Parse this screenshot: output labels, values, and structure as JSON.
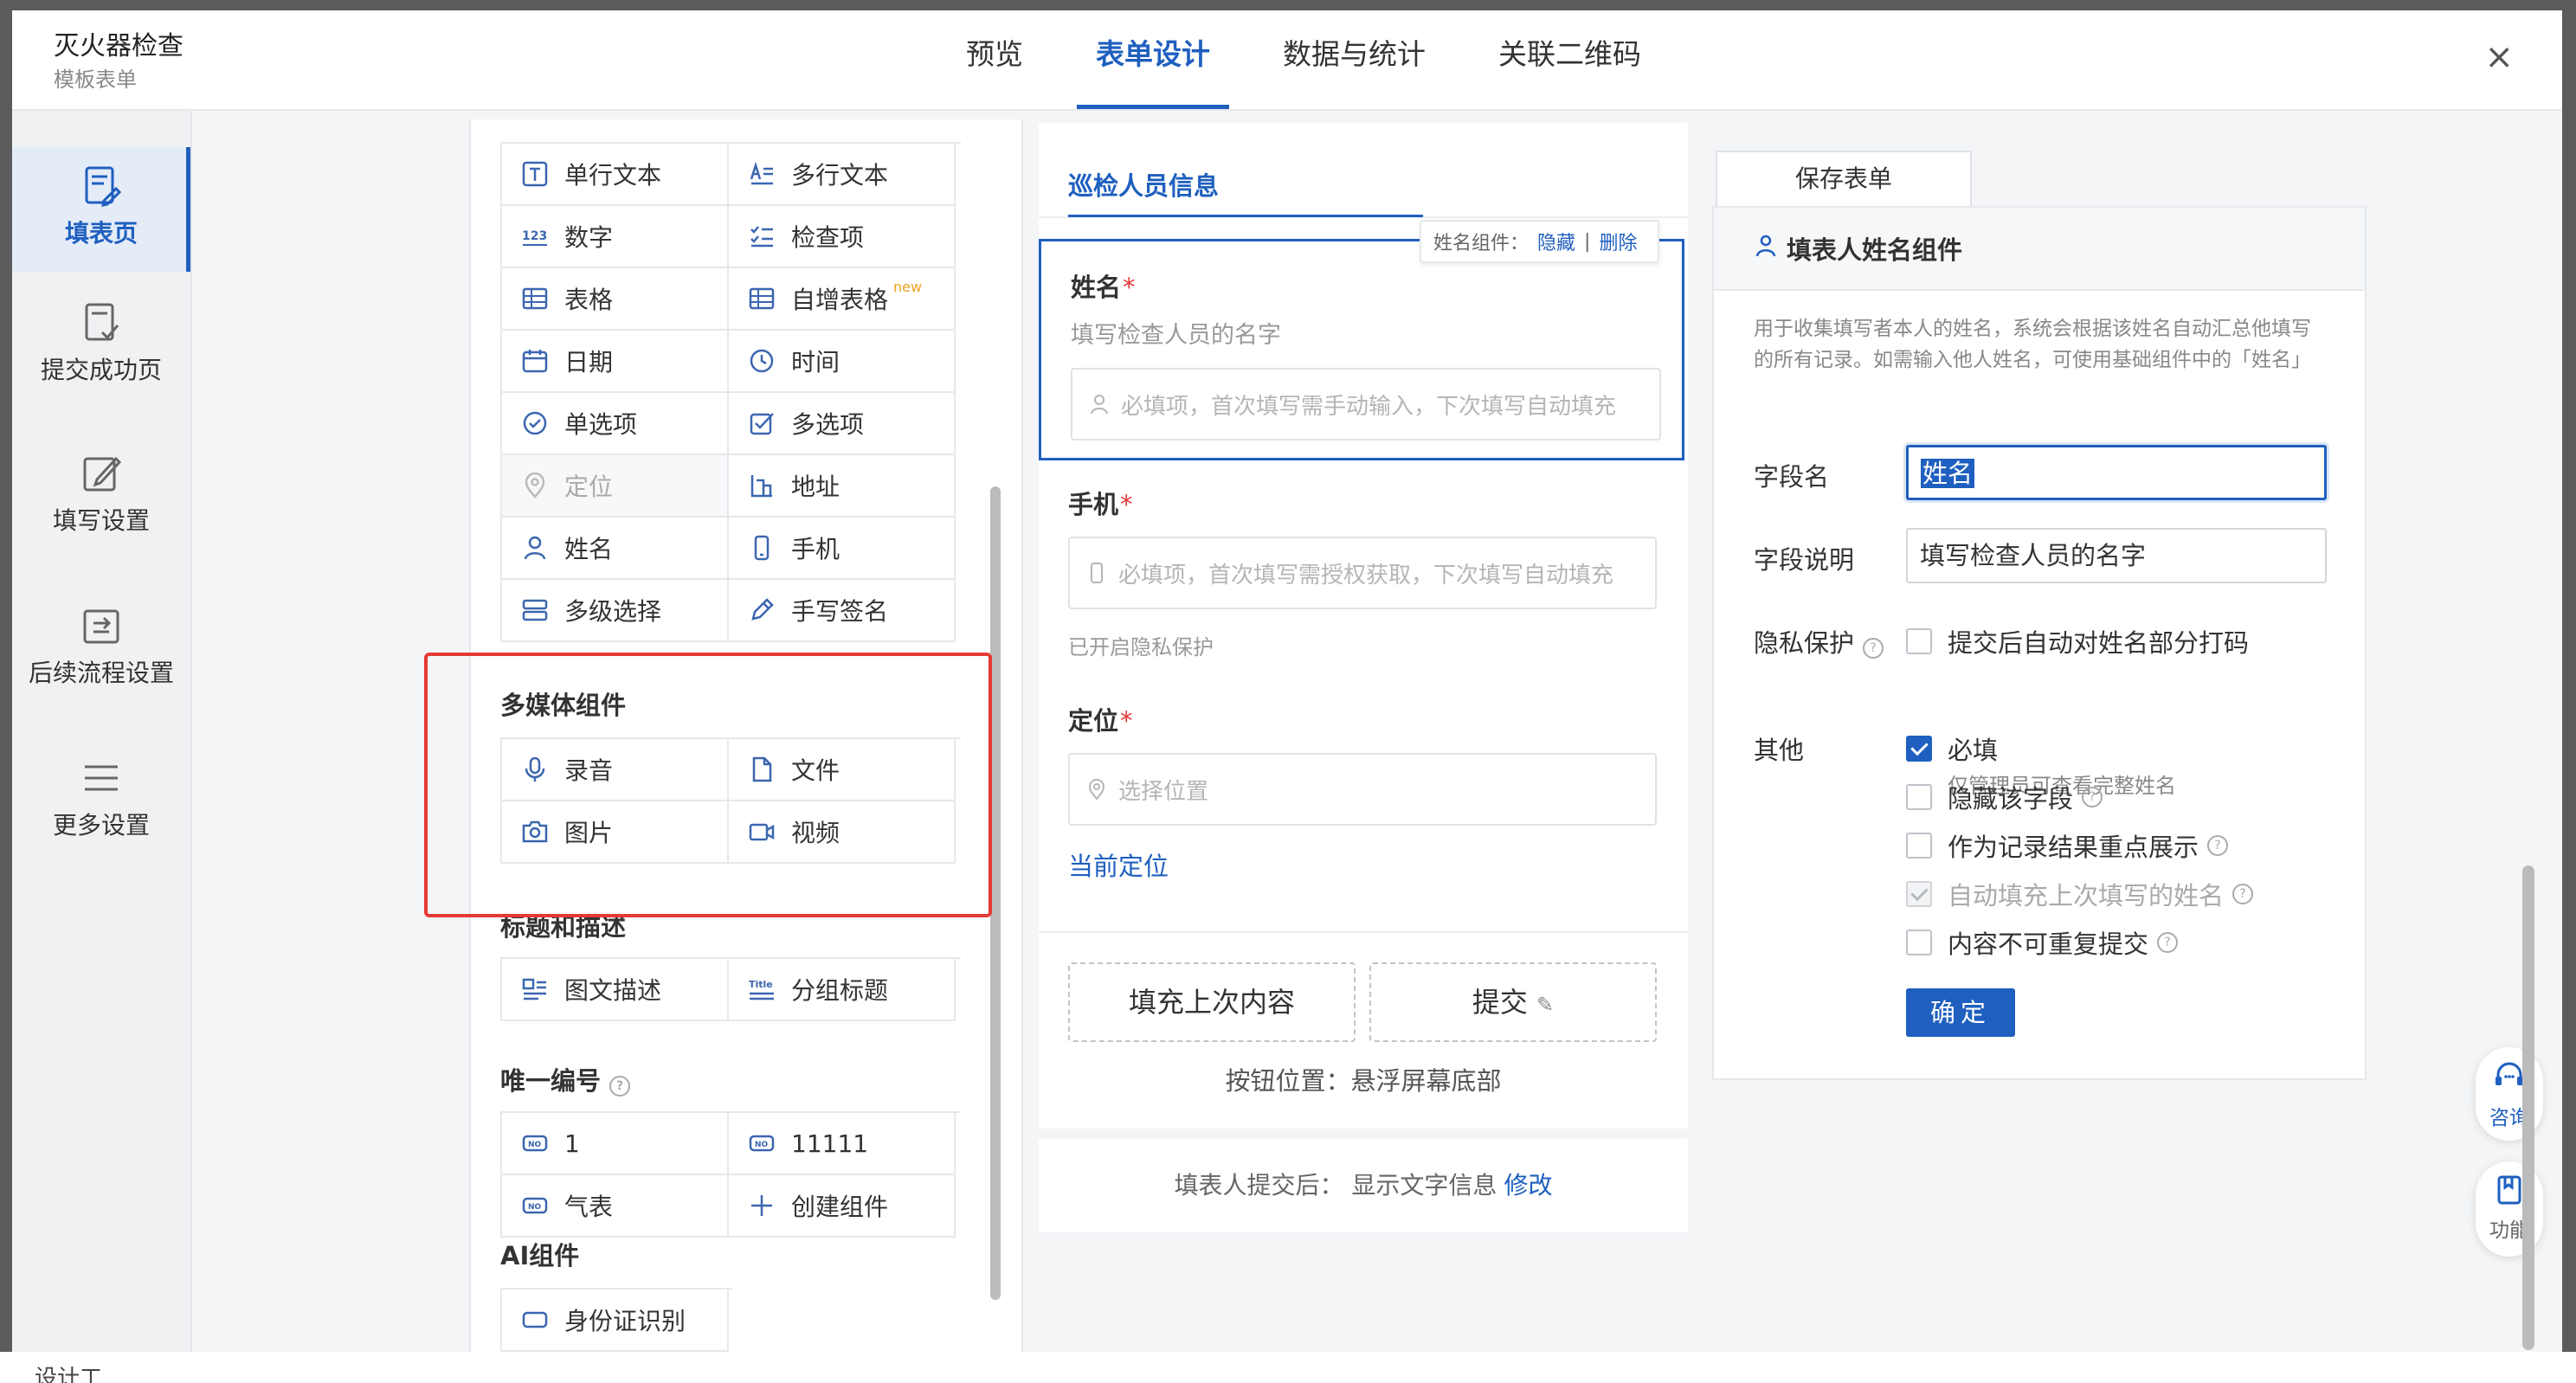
{
  "app": {
    "title": "灭火器检查",
    "subtitle": "模板表单",
    "close_label": "×"
  },
  "tabs": [
    "预览",
    "表单设计",
    "数据与统计",
    "关联二维码"
  ],
  "nav": [
    {
      "label": "填表页",
      "icon": "form-page-icon"
    },
    {
      "label": "提交成功页",
      "icon": "submit-success-icon"
    },
    {
      "label": "填写设置",
      "icon": "edit-settings-icon"
    },
    {
      "label": "后续流程设置",
      "icon": "workflow-icon"
    },
    {
      "label": "更多设置",
      "icon": "menu-lines-icon"
    }
  ],
  "components": {
    "basic": [
      {
        "label": "单行文本",
        "icon": "text-t-icon"
      },
      {
        "label": "多行文本",
        "icon": "multiline-text-icon"
      },
      {
        "label": "数字",
        "icon": "number-123-icon"
      },
      {
        "label": "检查项",
        "icon": "checklist-icon"
      },
      {
        "label": "表格",
        "icon": "table-icon"
      },
      {
        "label": "自增表格",
        "icon": "table-icon",
        "tag": "new"
      },
      {
        "label": "日期",
        "icon": "calendar-icon"
      },
      {
        "label": "时间",
        "icon": "clock-icon"
      },
      {
        "label": "单选项",
        "icon": "radio-check-icon"
      },
      {
        "label": "多选项",
        "icon": "checkbox-icon"
      },
      {
        "label": "定位",
        "icon": "location-pin-icon",
        "disabled": true
      },
      {
        "label": "地址",
        "icon": "address-icon"
      },
      {
        "label": "姓名",
        "icon": "person-icon"
      },
      {
        "label": "手机",
        "icon": "phone-icon"
      },
      {
        "label": "多级选择",
        "icon": "cascade-select-icon"
      },
      {
        "label": "手写签名",
        "icon": "pen-signature-icon"
      }
    ],
    "multimedia_title": "多媒体组件",
    "multimedia": [
      {
        "label": "录音",
        "icon": "microphone-icon"
      },
      {
        "label": "文件",
        "icon": "file-icon"
      },
      {
        "label": "图片",
        "icon": "camera-icon"
      },
      {
        "label": "视频",
        "icon": "video-icon"
      }
    ],
    "title_desc_title": "标题和描述",
    "title_desc": [
      {
        "label": "图文描述",
        "icon": "image-text-icon"
      },
      {
        "label": "分组标题",
        "icon": "group-title-icon"
      }
    ],
    "unique_title": "唯一编号",
    "unique": [
      {
        "label": "1",
        "icon": "no-badge-icon"
      },
      {
        "label": "11111",
        "icon": "no-badge-icon"
      },
      {
        "label": "气表",
        "icon": "no-badge-icon"
      },
      {
        "label": "创建组件",
        "icon": "plus-icon"
      }
    ],
    "ai_title": "AI组件",
    "ai": [
      {
        "label": "身份证识别",
        "icon": "id-card-icon"
      }
    ]
  },
  "form": {
    "section_title": "巡检人员信息",
    "tip": {
      "prefix": "姓名组件：",
      "hide": "隐藏",
      "sep": "|",
      "delete": "删除"
    },
    "fields": {
      "name": {
        "label": "姓名",
        "required": "*",
        "desc": "填写检查人员的名字",
        "placeholder": "必填项，首次填写需手动输入，下次填写自动填充"
      },
      "phone": {
        "label": "手机",
        "required": "*",
        "placeholder": "必填项，首次填写需授权获取，下次填写自动填充",
        "note": "已开启隐私保护"
      },
      "location": {
        "label": "定位",
        "required": "*",
        "placeholder": "选择位置",
        "link": "当前定位"
      }
    },
    "buttons": {
      "refill": "填充上次内容",
      "submit": "提交",
      "position": "按钮位置：悬浮屏幕底部"
    },
    "after": {
      "text": "填表人提交后： 显示文字信息",
      "link": "修改"
    }
  },
  "settings": {
    "save_tab": "保存表单",
    "title": "填表人姓名组件",
    "desc": "用于收集填写者本人的姓名，系统会根据该姓名自动汇总他填写的所有记录。如需输入他人姓名，可使用基础组件中的「姓名」",
    "field_name_label": "字段名",
    "field_name_value": "姓名",
    "field_desc_label": "字段说明",
    "field_desc_value": "填写检查人员的名字",
    "privacy_label": "隐私保护",
    "privacy_option": "提交后自动对姓名部分打码",
    "privacy_sub": "仅管理员可查看完整姓名",
    "other_label": "其他",
    "options": [
      {
        "label": "必填",
        "state": "checked"
      },
      {
        "label": "隐藏该字段",
        "state": "unchecked",
        "help": true
      },
      {
        "label": "作为记录结果重点展示",
        "state": "unchecked",
        "help": true
      },
      {
        "label": "自动填充上次填写的姓名",
        "state": "disabled-checked",
        "help": true
      },
      {
        "label": "内容不可重复提交",
        "state": "unchecked",
        "help": true
      }
    ],
    "ok": "确定"
  },
  "floating": [
    {
      "label": "咨询",
      "icon": "headset-icon"
    },
    {
      "label": "功能",
      "icon": "bookmark-icon"
    }
  ],
  "background_text": [
    "设计工"
  ],
  "colors": {
    "accent": "#1f5fbf",
    "highlight_box": "#e53935",
    "required": "#e53935"
  }
}
